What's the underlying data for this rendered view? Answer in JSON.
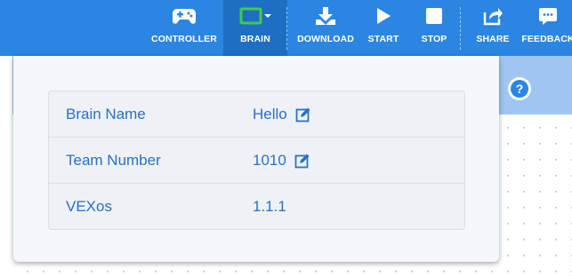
{
  "toolbar": {
    "items": [
      {
        "label": "CONTROLLER",
        "icon": "gamepad-icon"
      },
      {
        "label": "BRAIN",
        "icon": "brain-screen-icon",
        "active": true
      },
      {
        "label": "DOWNLOAD",
        "icon": "download-icon"
      },
      {
        "label": "START",
        "icon": "play-icon"
      },
      {
        "label": "STOP",
        "icon": "stop-icon"
      },
      {
        "label": "SHARE",
        "icon": "share-icon"
      },
      {
        "label": "FEEDBACK",
        "icon": "feedback-icon"
      }
    ],
    "colors": {
      "background": "#2b86e2",
      "active": "#1d6fc4",
      "brain_icon": "#3ecb4a"
    }
  },
  "help": {
    "label": "?"
  },
  "brain_info": {
    "rows": [
      {
        "label": "Brain Name",
        "value": "Hello",
        "editable": true
      },
      {
        "label": "Team Number",
        "value": "1010",
        "editable": true
      },
      {
        "label": "VEXos",
        "value": "1.1.1",
        "editable": false
      }
    ],
    "text_color": "#2a6fc9"
  }
}
